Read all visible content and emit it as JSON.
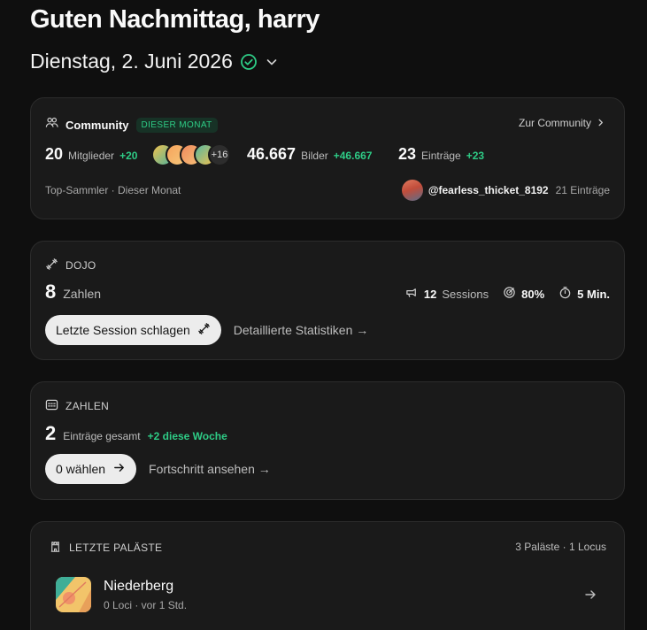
{
  "greeting": "Guten Nachmittag, harry",
  "date": "Dienstag, 2. Juni 2026",
  "colors": {
    "accent_green": "#2ecc86",
    "card_bg": "#1a1a1a",
    "page_bg": "#0f0f0f"
  },
  "community": {
    "title": "Community",
    "badge": "DIESER MONAT",
    "link": "Zur Community",
    "members": {
      "value": "20",
      "label": "Mitglieder",
      "delta": "+20"
    },
    "avatars_more": "+16",
    "images": {
      "value": "46.667",
      "label": "Bilder",
      "delta": "+46.667"
    },
    "entries": {
      "value": "23",
      "label": "Einträge",
      "delta": "+23"
    },
    "top_label": "Top-Sammler · Dieser Monat",
    "top_user": "@fearless_thicket_8192",
    "top_entries": "21 Einträge"
  },
  "dojo": {
    "title": "DOJO",
    "big_value": "8",
    "big_label": "Zahlen",
    "sessions_value": "12",
    "sessions_label": "Sessions",
    "accuracy": "80%",
    "duration": "5 Min.",
    "primary_button": "Letzte Session schlagen",
    "secondary_link": "Detaillierte Statistiken →"
  },
  "zahlen": {
    "title": "ZAHLEN",
    "big_value": "2",
    "big_label": "Einträge gesamt",
    "delta": "+2 diese Woche",
    "primary_button": "0 wählen",
    "secondary_link": "Fortschritt ansehen →"
  },
  "palaces": {
    "title": "LETZTE PALÄSTE",
    "count": "3 Paläste · 1 Locus",
    "items": [
      {
        "name": "Niederberg",
        "meta": "0 Loci · vor 1 Std."
      }
    ]
  }
}
